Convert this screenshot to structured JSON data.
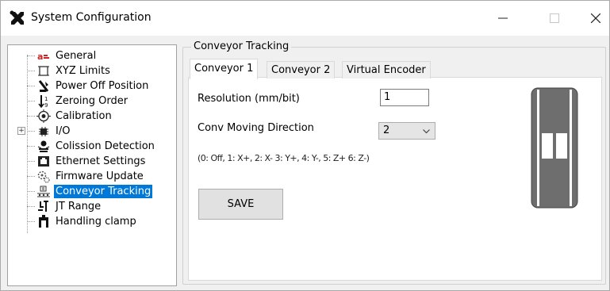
{
  "window": {
    "title": "System Configuration",
    "controls": {
      "minimize": "—",
      "maximize": "☐",
      "close": "✕"
    }
  },
  "tree": {
    "items": [
      {
        "label": "General",
        "icon": "general-icon"
      },
      {
        "label": "XYZ Limits",
        "icon": "xyz-limits-icon"
      },
      {
        "label": "Power Off Position",
        "icon": "power-off-position-icon"
      },
      {
        "label": "Zeroing Order",
        "icon": "zeroing-order-icon"
      },
      {
        "label": "Calibration",
        "icon": "calibration-icon"
      },
      {
        "label": "I/O",
        "icon": "io-icon",
        "expander": "+"
      },
      {
        "label": "Colission Detection",
        "icon": "collision-detection-icon"
      },
      {
        "label": "Ethernet Settings",
        "icon": "ethernet-icon"
      },
      {
        "label": "Firmware Update",
        "icon": "firmware-update-icon"
      },
      {
        "label": "Conveyor Tracking",
        "icon": "conveyor-tracking-icon",
        "selected": true
      },
      {
        "label": "JT Range",
        "icon": "jt-range-icon"
      },
      {
        "label": "Handling clamp",
        "icon": "handling-clamp-icon"
      }
    ]
  },
  "group": {
    "title": "Conveyor Tracking"
  },
  "tabs": [
    {
      "label": "Conveyor 1",
      "active": true
    },
    {
      "label": "Conveyor 2",
      "active": false
    },
    {
      "label": "Virtual Encoder",
      "active": false
    }
  ],
  "form": {
    "resolution_label": "Resolution (mm/bit)",
    "resolution_value": "1",
    "direction_label": "Conv Moving Direction",
    "direction_value": "2",
    "direction_hint": "(0: Off, 1: X+, 2: X- 3: Y+, 4: Y-, 5: Z+ 6: Z-)",
    "save_label": "SAVE"
  },
  "colors": {
    "selection": "#0078d7",
    "window_bg": "#f0f0f0",
    "conveyor_dark": "#6e6e6e"
  }
}
